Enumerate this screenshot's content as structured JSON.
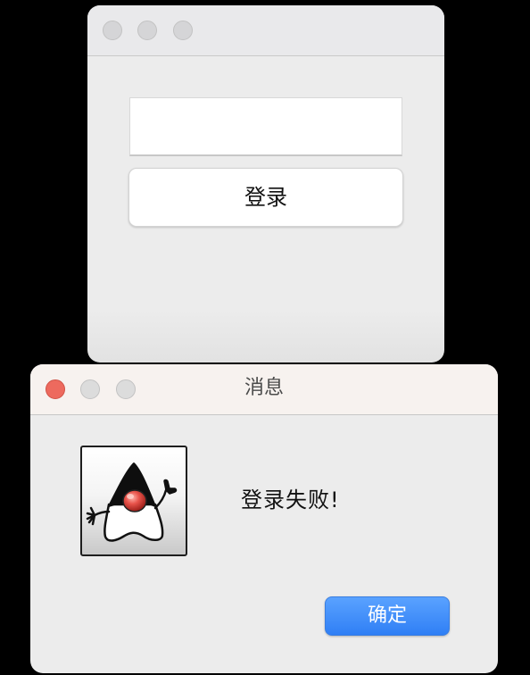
{
  "login_window": {
    "login_button_label": "登录",
    "username_value": ""
  },
  "message_dialog": {
    "title": "消息",
    "message": "登录失败!",
    "ok_button_label": "确定",
    "icon": "java-duke-icon"
  },
  "colors": {
    "close_red": "#ed6a5e",
    "ok_button_blue": "#2f7ff5",
    "window_background": "#ececec"
  }
}
